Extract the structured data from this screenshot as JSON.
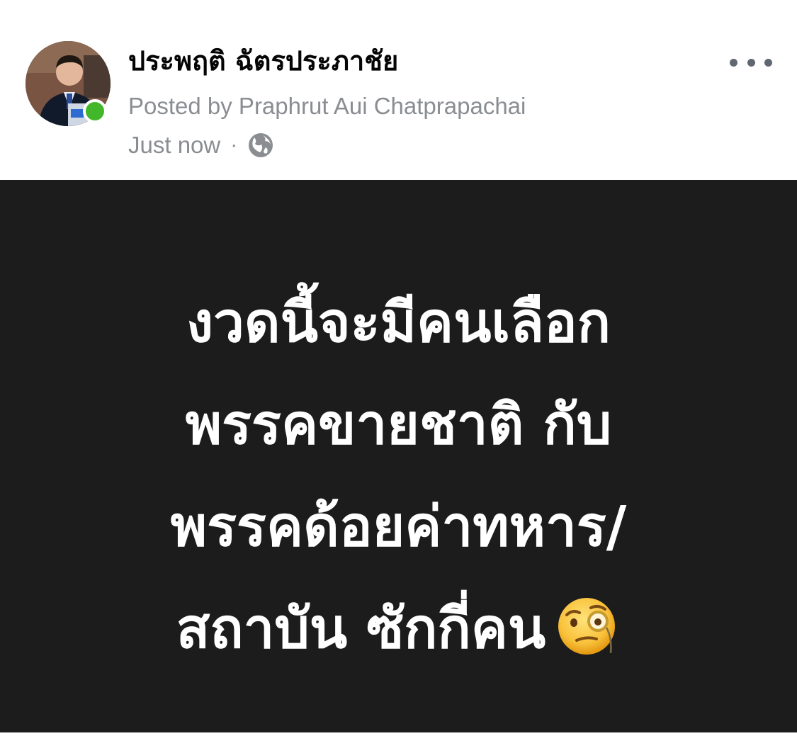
{
  "post": {
    "author": {
      "name": "ประพฤติ ฉัตรประภาชัย",
      "posted_by": "Posted by Praphrut Aui Chatprapachai",
      "online": true,
      "avatar_icon": "avatar-photo"
    },
    "meta": {
      "timestamp": "Just now",
      "separator": "·",
      "audience_icon": "globe-icon"
    },
    "more_icon": "more-options-icon",
    "content": {
      "background_color": "#1c1c1c",
      "text_color": "#ffffff",
      "lines": [
        "งวดนี้จะมีคนเลือก",
        "พรรคขายชาติ กับ",
        "พรรคด้อยค่าทหาร/",
        "สถาบัน ซักกี่คน"
      ],
      "emoji_icon": "face-with-monocle-emoji"
    }
  }
}
